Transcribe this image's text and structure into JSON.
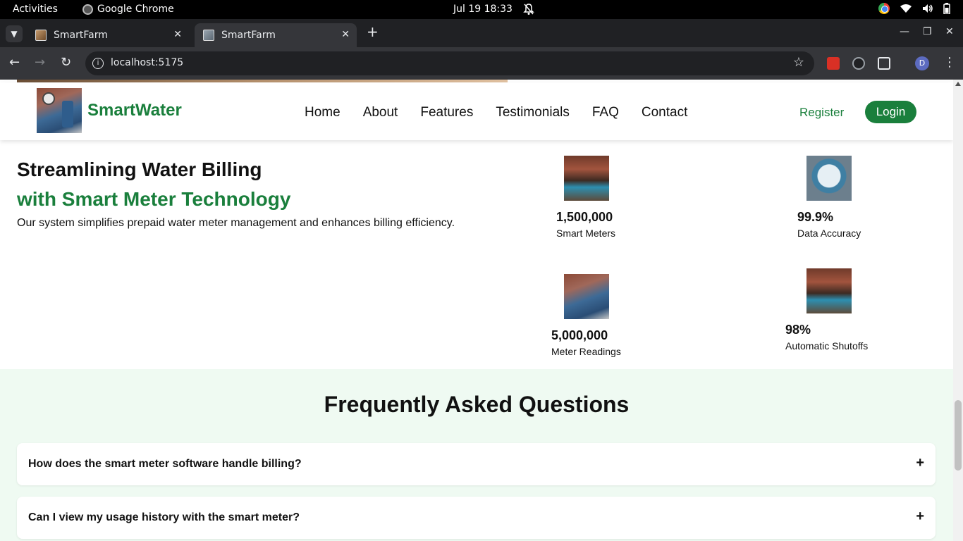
{
  "system_bar": {
    "activities": "Activities",
    "app_name": "Google Chrome",
    "clock": "Jul 19  18:33"
  },
  "browser": {
    "tabs": [
      {
        "title": "SmartFarm",
        "active": false
      },
      {
        "title": "SmartFarm",
        "active": true
      }
    ],
    "url": "localhost:5175",
    "profile_initial": "D"
  },
  "header": {
    "brand": "SmartWater",
    "nav": [
      "Home",
      "About",
      "Features",
      "Testimonials",
      "FAQ",
      "Contact"
    ],
    "register": "Register",
    "login": "Login"
  },
  "hero": {
    "title_line1": "Streamlining Water Billing",
    "title_line2": "with Smart Meter Technology",
    "description": "Our system simplifies prepaid water meter management and enhances billing efficiency."
  },
  "stats": [
    {
      "value": "1,500,000",
      "label": "Smart Meters",
      "image": "people-at-water-tap"
    },
    {
      "value": "99.9%",
      "label": "Data Accuracy",
      "image": "hand-holding-meter"
    },
    {
      "value": "5,000,000",
      "label": "Meter Readings",
      "image": "meter-pipes"
    },
    {
      "value": "98%",
      "label": "Automatic Shutoffs",
      "image": "people-at-water-tap"
    }
  ],
  "faq": {
    "title": "Frequently Asked Questions",
    "items": [
      {
        "question": "How does the smart meter software handle billing?",
        "toggle": "+"
      },
      {
        "question": "Can I view my usage history with the smart meter?",
        "toggle": "+"
      }
    ]
  },
  "colors": {
    "brand_green": "#1a7f3c",
    "faq_background": "#effaf2",
    "chrome_dark": "#202124",
    "chrome_toolbar": "#35363a"
  }
}
